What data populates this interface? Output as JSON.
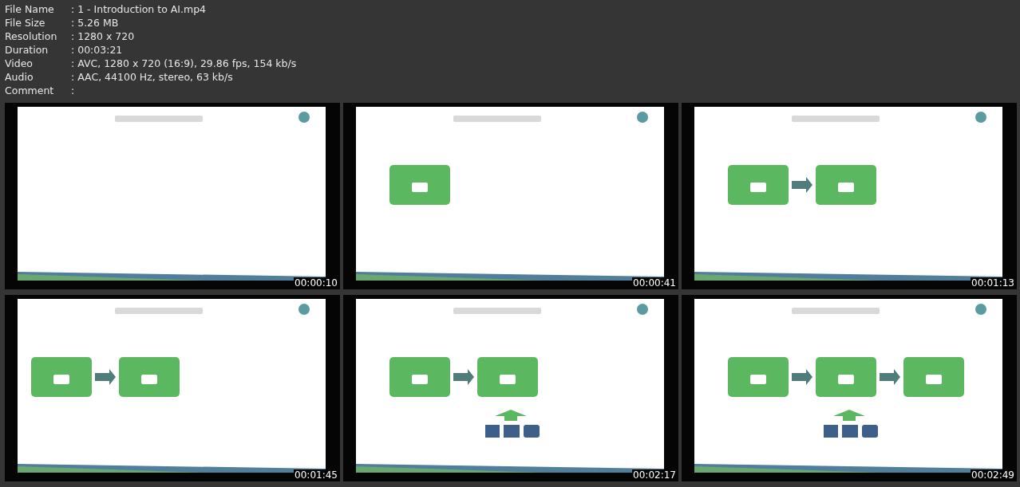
{
  "info": [
    {
      "label": "File Name",
      "value": ": 1 - Introduction to AI.mp4"
    },
    {
      "label": "File Size",
      "value": ": 5.26 MB"
    },
    {
      "label": "Resolution",
      "value": ": 1280 x 720"
    },
    {
      "label": "Duration",
      "value": ": 00:03:21"
    },
    {
      "label": "Video",
      "value": ": AVC, 1280 x 720 (16:9), 29.86 fps, 154 kb/s"
    },
    {
      "label": "Audio",
      "value": ": AAC, 44100 Hz, stereo, 63 kb/s"
    },
    {
      "label": "Comment",
      "value": ":"
    }
  ],
  "thumbnails": [
    {
      "kind": "picture",
      "time": "00:00:10"
    },
    {
      "kind": "picture",
      "time": "00:00:41"
    },
    {
      "kind": "picture",
      "time": "00:01:13"
    },
    {
      "kind": "picture",
      "time": "00:01:45"
    },
    {
      "kind": "picture",
      "time": "00:02:17"
    },
    {
      "kind": "picture",
      "time": "00:02:49"
    }
  ]
}
